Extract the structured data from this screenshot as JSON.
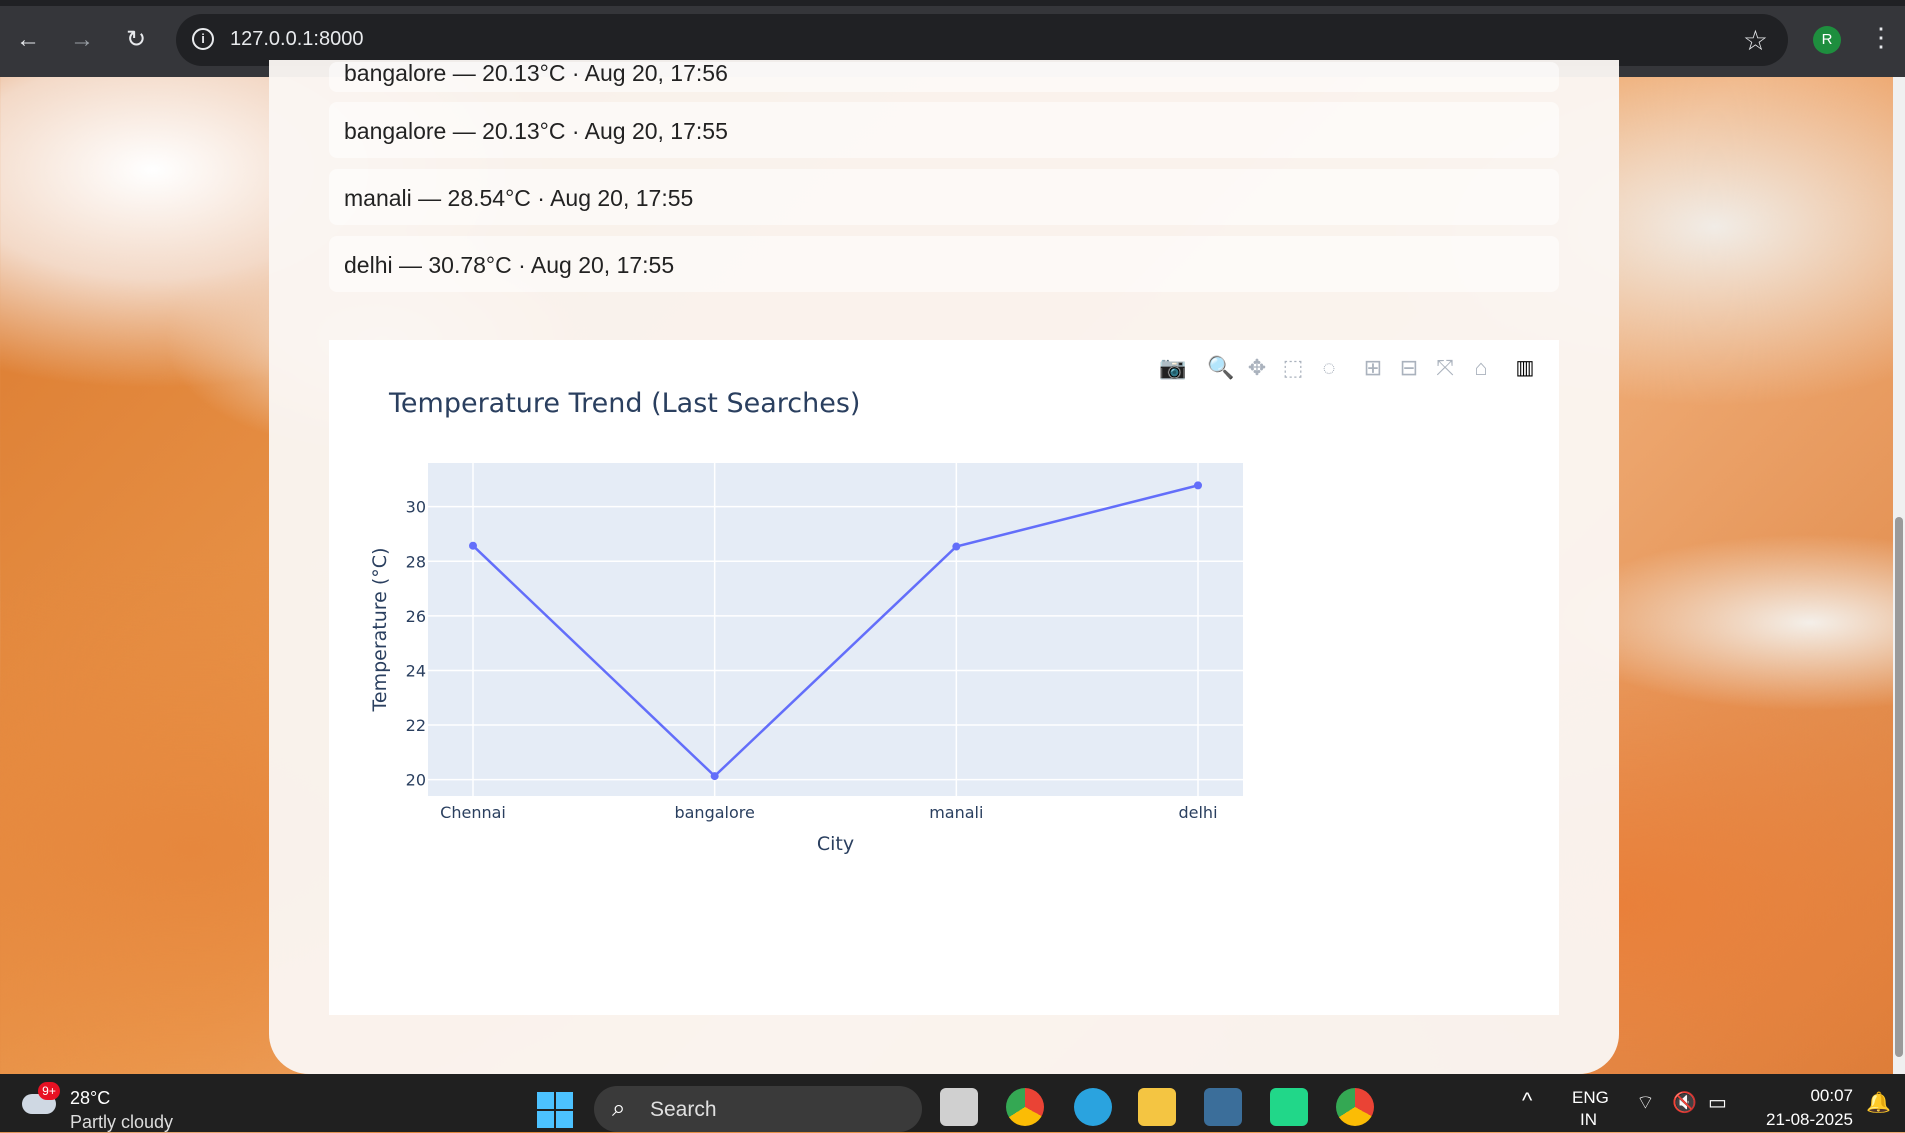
{
  "browser": {
    "url": "127.0.0.1:8000",
    "profile_initial": "R"
  },
  "history": [
    {
      "text": "bangalore — 20.13°C · Aug 20, 17:56"
    },
    {
      "text": "bangalore — 20.13°C · Aug 20, 17:55"
    },
    {
      "text": "manali — 28.54°C · Aug 20, 17:55"
    },
    {
      "text": "delhi — 30.78°C · Aug 20, 17:55"
    }
  ],
  "chart_data": {
    "type": "line",
    "title": "Temperature Trend (Last Searches)",
    "xlabel": "City",
    "ylabel": "Temperature (°C)",
    "categories": [
      "Chennai",
      "bangalore",
      "manali",
      "delhi"
    ],
    "values": [
      28.57,
      20.13,
      28.54,
      30.78
    ],
    "yticks": [
      20,
      22,
      24,
      26,
      28,
      30
    ],
    "ylim": [
      19.4,
      31.6
    ],
    "grid": true,
    "line_color": "#636efa",
    "plot_bg": "#e5ecf6"
  },
  "taskbar": {
    "weather_temp": "28°C",
    "weather_desc": "Partly cloudy",
    "weather_badge": "9+",
    "search_label": "Search",
    "lang_line1": "ENG",
    "lang_line2": "IN",
    "time": "00:07",
    "date": "21-08-2025"
  }
}
